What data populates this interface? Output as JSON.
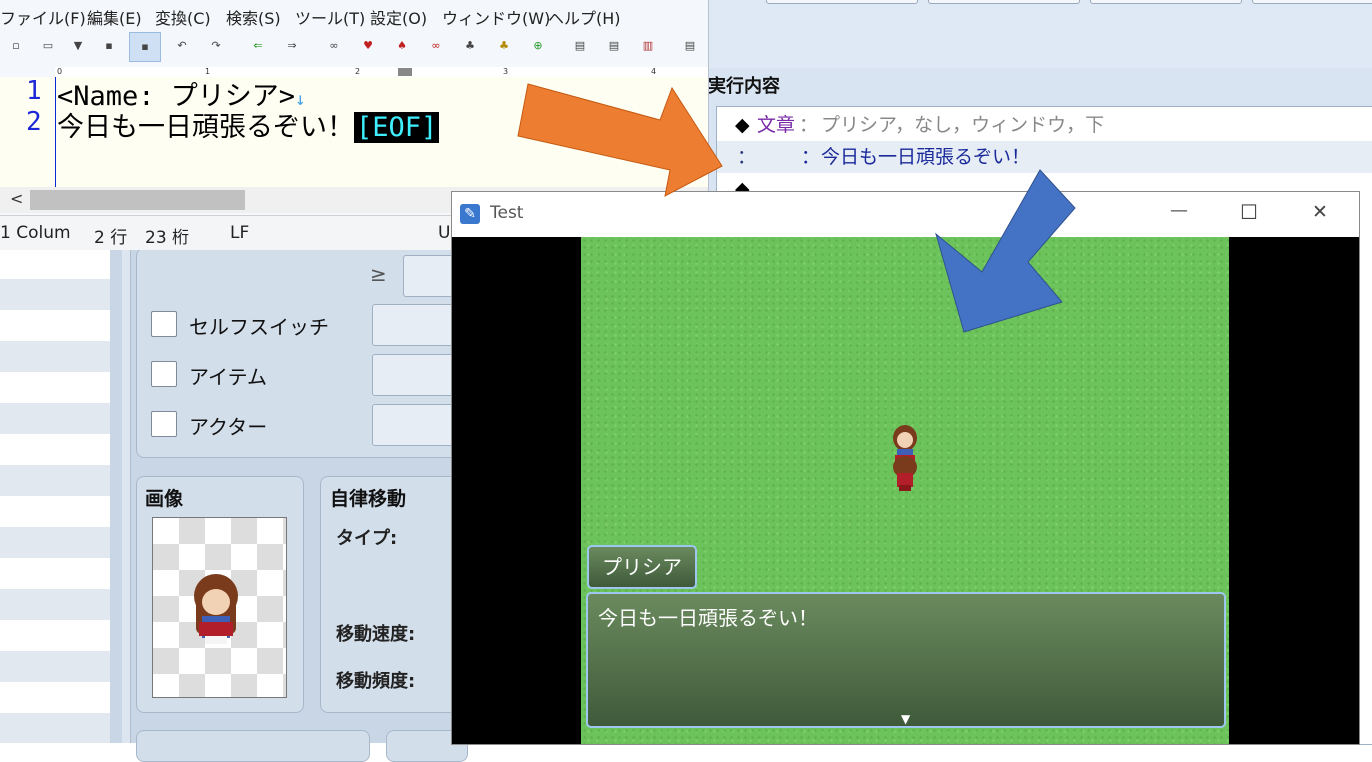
{
  "editor": {
    "menu": [
      "ファイル(F)",
      "編集(E)",
      "変換(C)",
      "検索(S)",
      "ツール(T)",
      "設定(O)",
      "ウィンドウ(W)",
      "ヘルプ(H)"
    ],
    "ruler_labels": [
      "0",
      "1",
      "2",
      "3",
      "4"
    ],
    "lines": [
      {
        "num": "1",
        "text": "<Name: プリシア>",
        "eol": "↓"
      },
      {
        "num": "2",
        "text": "今日も一日頑張るぞい！",
        "eof": "[EOF]"
      }
    ],
    "scroll_left": "<",
    "status": {
      "mode": "1 Colum",
      "row": "2 行",
      "col": "23 桁",
      "eol": "LF",
      "enc": "U"
    }
  },
  "exec": {
    "heading": "実行内容",
    "chevron": "^",
    "rows": [
      {
        "marker": "◆",
        "cmd": "文章",
        "sep": "：",
        "args": "プリシア，なし，ウィンドウ，下"
      },
      {
        "marker": "：",
        "cmd": "",
        "sep": "：",
        "args": "今日も一日頑張るぞい！"
      },
      {
        "marker": "◆",
        "cmd": "",
        "sep": "",
        "args": ""
      }
    ]
  },
  "database": {
    "ge_symbol": "≥",
    "checkboxes": [
      "セルフスイッチ",
      "アイテム",
      "アクター"
    ],
    "image_group": "画像",
    "autonomous": {
      "title": "自律移動",
      "type_label": "タイプ:",
      "speed_label": "移動速度:",
      "freq_label": "移動頻度:"
    }
  },
  "game": {
    "title": "Test",
    "speaker": "プリシア",
    "message": "今日も一日頑張るぞい！",
    "continue_indicator": "▼",
    "controls": {
      "minimize": "—",
      "maximize": "☐",
      "close": "✕"
    }
  },
  "colors": {
    "orange_arrow": "#ed7d31",
    "blue_arrow": "#4472c4"
  }
}
